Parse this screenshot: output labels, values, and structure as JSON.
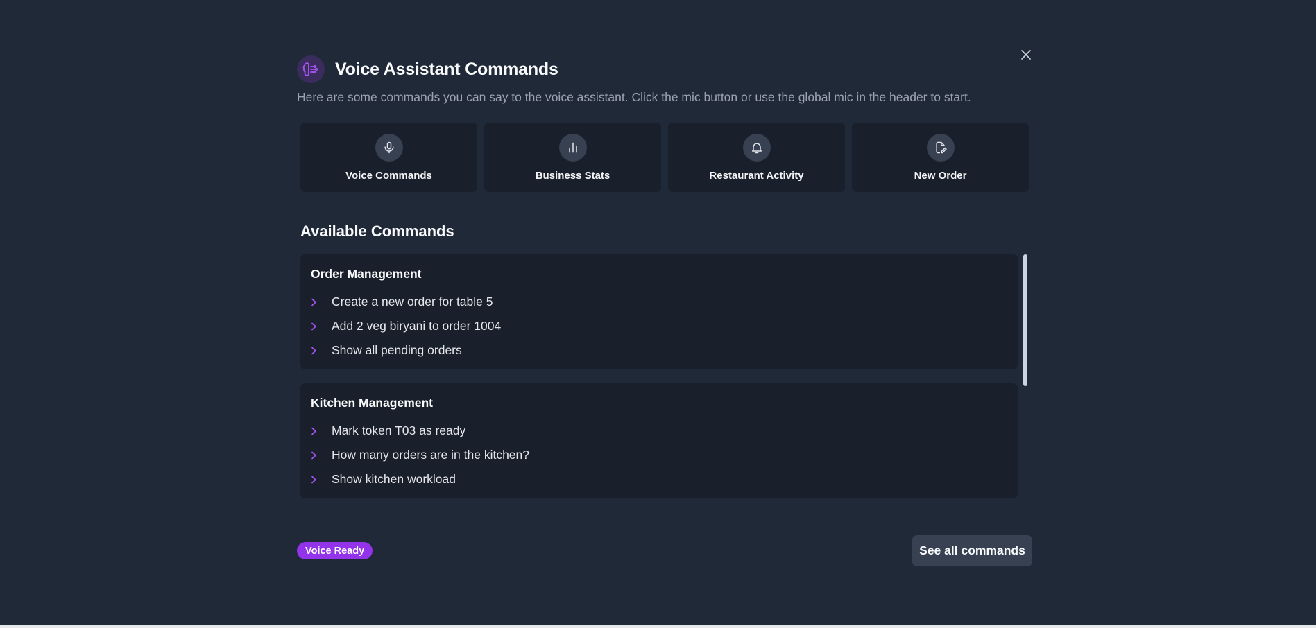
{
  "modal": {
    "title": "Voice Assistant Commands",
    "subtitle": "Here are some commands you can say to the voice assistant. Click the mic button or use the global mic in the header to start.",
    "title_icon": "brain-icon",
    "close_icon": "close-icon"
  },
  "quick_actions": [
    {
      "label": "Voice Commands",
      "icon": "microphone-icon"
    },
    {
      "label": "Business Stats",
      "icon": "bar-chart-icon"
    },
    {
      "label": "Restaurant Activity",
      "icon": "bell-icon"
    },
    {
      "label": "New Order",
      "icon": "edit-document-icon"
    }
  ],
  "section_title": "Available Commands",
  "command_groups": [
    {
      "title": "Order Management",
      "commands": [
        "Create a new order for table 5",
        "Add 2 veg biryani to order 1004",
        "Show all pending orders"
      ]
    },
    {
      "title": "Kitchen Management",
      "commands": [
        "Mark token T03 as ready",
        "How many orders are in the kitchen?",
        "Show kitchen workload"
      ]
    }
  ],
  "footer": {
    "status_badge": "Voice Ready",
    "see_all_button": "See all commands"
  },
  "colors": {
    "background": "#202938",
    "card": "#1a202b",
    "accent": "#9333ea",
    "chevron": "#a855f7",
    "button": "#374151"
  }
}
